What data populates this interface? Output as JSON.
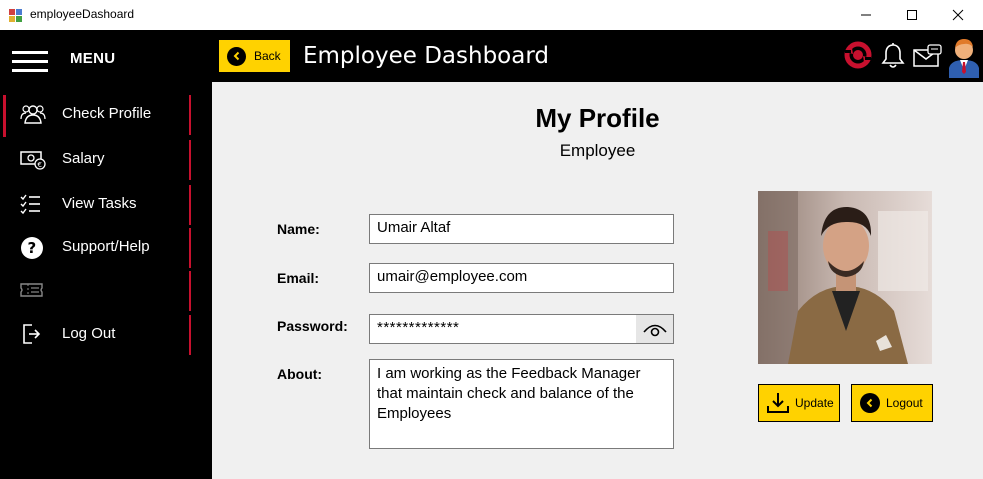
{
  "window": {
    "title": "employeeDashoard"
  },
  "header": {
    "menu_label": "MENU",
    "back_label": "Back",
    "title": "Employee Dashboard"
  },
  "sidebar": {
    "items": [
      {
        "label": "Check Profile",
        "icon": "users-icon"
      },
      {
        "label": "Salary",
        "icon": "money-icon"
      },
      {
        "label": "View Tasks",
        "icon": "tasks-icon"
      },
      {
        "label": "Support/Help",
        "icon": "help-icon"
      },
      {
        "label": "",
        "icon": "ticket-icon"
      },
      {
        "label": "Log Out",
        "icon": "logout-icon"
      }
    ]
  },
  "profile": {
    "title": "My Profile",
    "subtitle": "Employee",
    "name_label": "Name:",
    "name_value": "Umair Altaf",
    "email_label": "Email:",
    "email_value": "umair@employee.com",
    "password_label": "Password:",
    "password_value": "*************",
    "about_label": "About:",
    "about_value": "I am working as the Feedback Manager that maintain check and balance of the Employees",
    "update_label": "Update",
    "logout_label": "Logout"
  },
  "colors": {
    "accent": "#ffd200",
    "sidebar_bg": "#000000",
    "indicator": "#c8102e",
    "content_bg": "#f0f0f0"
  }
}
